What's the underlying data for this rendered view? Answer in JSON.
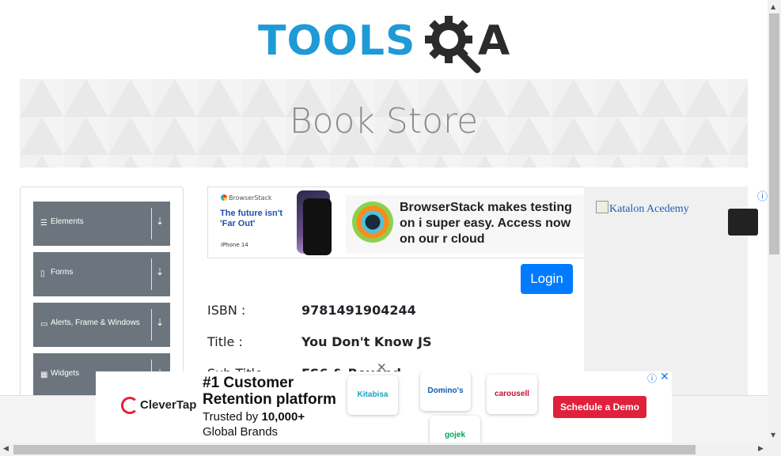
{
  "logo": {
    "part1": "TOOLS",
    "part2": "QA",
    "icon": "gear-icon"
  },
  "banner": {
    "title": "Book Store"
  },
  "sidebar": {
    "groups": [
      {
        "label": "Elements",
        "icon": "hamburger-icon"
      },
      {
        "label": "Forms",
        "icon": "document-icon"
      },
      {
        "label": "Alerts, Frame & Windows",
        "icon": "window-icon"
      },
      {
        "label": "Widgets",
        "icon": "grid-icon"
      }
    ],
    "arrow_icon": "download-arrow-icon"
  },
  "top_ad": {
    "brand": "BrowserStack",
    "tagline": "The future isn't 'Far Out'",
    "device_line": "iPhone 14",
    "headline": "BrowserStack makes testing on i super easy. Access now on our r cloud"
  },
  "right_ad": {
    "image_alt": "Katalon Acedemy"
  },
  "login": {
    "label": "Login"
  },
  "book": {
    "isbn_label": "ISBN :",
    "isbn_value": "9781491904244",
    "title_label": "Title :",
    "title_value": "You Don't Know JS",
    "subtitle_label": "Sub Title",
    "subtitle_value": "ES6 & Beyond"
  },
  "bottom_ad": {
    "brand": "CleverTap",
    "headline": "#1 Customer Retention platform",
    "subline_pre": "Trusted by ",
    "subline_bold": "10,000+",
    "subline_post": "Global Brands",
    "cards": [
      "Kitabisa",
      "Domino's",
      "carousell",
      "gojek"
    ],
    "cta": "Schedule a Demo"
  },
  "colors": {
    "primary": "#007bff",
    "sidebar": "#6c757d",
    "brand_blue": "#1e9ad6",
    "cta_red": "#e0213b"
  }
}
